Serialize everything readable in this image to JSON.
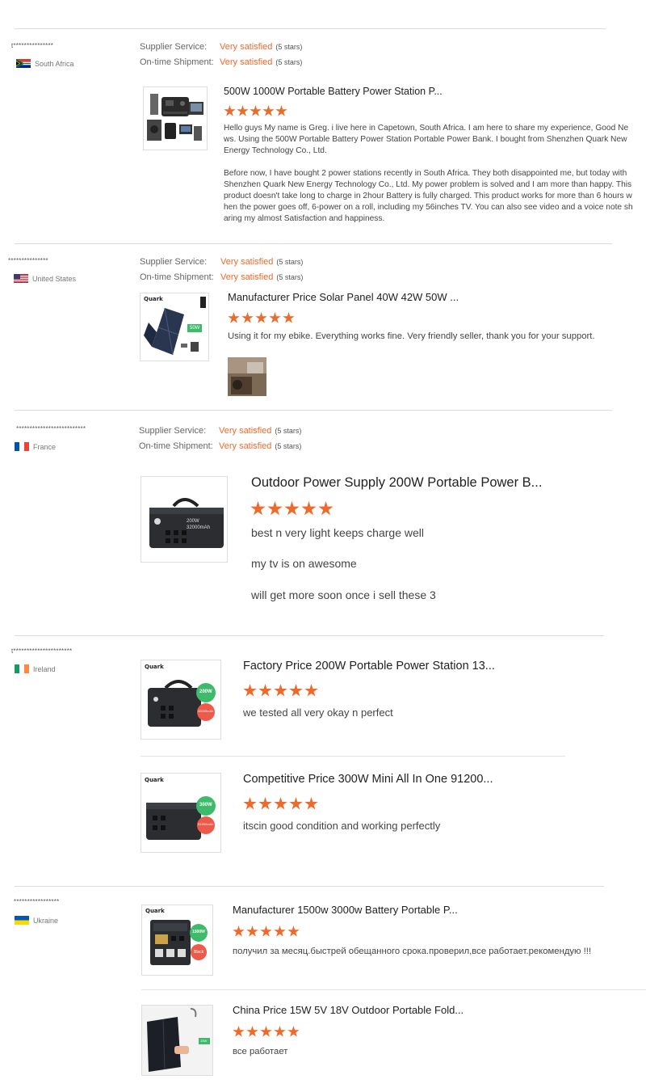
{
  "meta_labels": {
    "supplier_service": "Supplier Service:",
    "ontime_shipment": "On-time Shipment:",
    "very_satisfied": "Very satisfied",
    "five_stars": "(5 stars)"
  },
  "colors": {
    "accent": "#ee6a2a",
    "divider": "#dcdcdc"
  },
  "reviews": [
    {
      "reviewer": "t***************",
      "country": "South Africa",
      "flag": "za",
      "products": [
        {
          "title": "500W 1000W Portable Battery Power Station P...",
          "rating": 5,
          "text": [
            "Hello guys My name is Greg. i live here in Capetown, South Africa. I am here to share my experience, Good News. Using the 500W Portable Battery Power Station Portable Power Bank. I bought from Shenzhen Quark New Energy Technology Co., Ltd.",
            "Before now, I have bought 2 power stations recently in South Africa. They both disappointed me, but today with Shenzhen Quark New Energy Technology Co., Ltd. My power problem is solved and I am more than happy. This product doesn't take long to charge in 2hour Battery is fully charged. This product works for more than 6 hours when the power goes off, 6-power on a roll, including my 56inches TV. You can also see video and a voice note sharing my almost Satisfaction and happiness."
          ]
        }
      ]
    },
    {
      "reviewer": "***************",
      "country": "United States",
      "flag": "us",
      "products": [
        {
          "title": "Manufacturer Price Solar Panel 40W 42W 50W ...",
          "rating": 5,
          "brand": "Quark",
          "badge": "50W",
          "text": [
            "Using it for my ebike. Everything works fine. Very friendly seller, thank you for your support."
          ]
        }
      ]
    },
    {
      "reviewer": "**************************",
      "country": "France",
      "flag": "fr",
      "products": [
        {
          "title": "Outdoor Power Supply 200W Portable Power B...",
          "rating": 5,
          "device_label_1": "200W",
          "device_label_2": "32000mAh",
          "text": [
            "best n very light keeps charge well",
            "my tv is on awesome",
            "will get more soon once i sell these 3"
          ]
        }
      ]
    },
    {
      "reviewer": "t**********************",
      "country": "Ireland",
      "flag": "ie",
      "products": [
        {
          "title": "Factory Price 200W Portable Power Station 13...",
          "rating": 5,
          "brand": "Quark",
          "badge": "200W",
          "badge2": "32000mAh",
          "text": [
            "we tested all very okay n perfect"
          ]
        },
        {
          "title": "Competitive Price 300W Mini All In One 91200...",
          "rating": 5,
          "brand": "Quark",
          "badge": "300W",
          "badge2": "91200mAh",
          "text": [
            "itscin good condition and working perfectly"
          ]
        }
      ]
    },
    {
      "reviewer": "*****************",
      "country": "Ukraine",
      "flag": "ua",
      "products": [
        {
          "title": "Manufacturer 1500w 3000w Battery Portable P...",
          "rating": 5,
          "brand": "Quark",
          "badge": "1500W",
          "badge2": "Black",
          "text": [
            "получил за месяц.быстрей обещанного срока.проверил,все работает.рекомендую !!!"
          ]
        },
        {
          "title": "China Price 15W 5V 18V Outdoor Portable Fold...",
          "rating": 5,
          "badge": "15W",
          "text": [
            "все работает"
          ]
        }
      ]
    }
  ]
}
